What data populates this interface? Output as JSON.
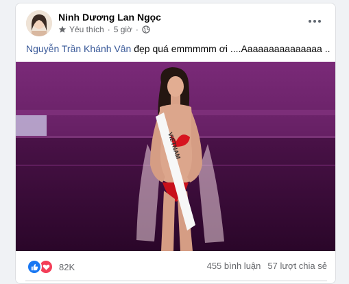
{
  "post": {
    "author_name": "Ninh Dương Lan Ngọc",
    "meta_liked": "Yêu thích",
    "meta_separator": "·",
    "meta_time": "5 giờ",
    "text_mention": "Nguyễn Trần Khánh Vân",
    "text_body": " đẹp quá emmmmm ơi ....Aaaaaaaaaaaaaaa .."
  },
  "footer": {
    "reaction_count": "82K",
    "comments": "455 bình luận",
    "shares": "57 lượt chia sẻ"
  },
  "colors": {
    "mention": "#385898",
    "like": "#1877f2",
    "love": "#f33e58",
    "stage_background": "#6a1f66"
  },
  "image": {
    "sash_text": "VIETNAM"
  }
}
